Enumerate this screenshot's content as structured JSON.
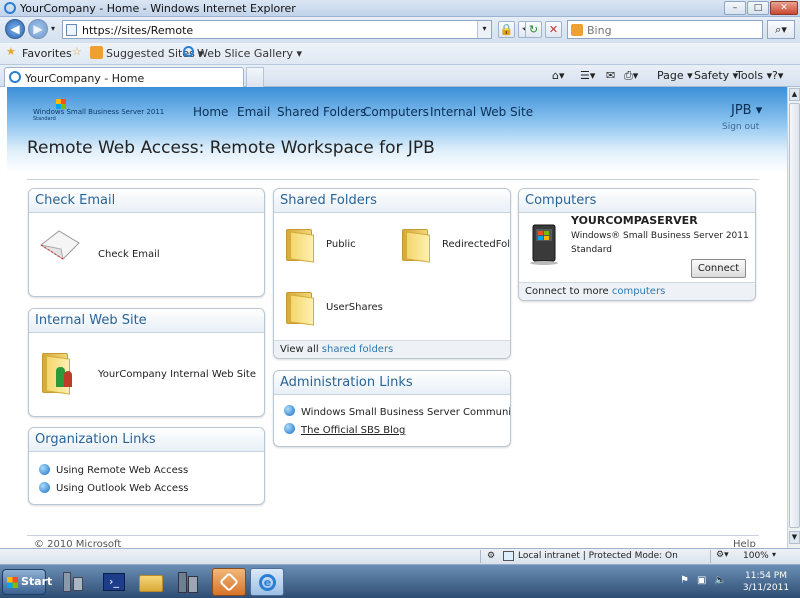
{
  "window": {
    "title": "YourCompany - Home - Windows Internet Explorer",
    "minimize": "–",
    "maximize": "□",
    "close": "✕"
  },
  "address_bar": {
    "url": "https://sites/Remote",
    "search_placeholder": "Bing"
  },
  "favorites_bar": {
    "favorites_label": "Favorites",
    "suggested_sites": "Suggested Sites ▾",
    "web_slice_gallery": "Web Slice Gallery ▾"
  },
  "tabs": [
    {
      "label": "YourCompany - Home"
    }
  ],
  "command_bar": {
    "page": "Page ▾",
    "safety": "Safety ▾",
    "tools": "Tools ▾",
    "help": "?▾"
  },
  "header": {
    "logo_line1": "Windows Small Business Server 2011",
    "logo_line2": "Standard",
    "nav": [
      "Home",
      "Email",
      "Shared Folders",
      "Computers",
      "Internal Web Site"
    ],
    "user": "JPB ▾",
    "sign_out": "Sign out",
    "page_title": "Remote Web Access: Remote Workspace for JPB"
  },
  "check_email": {
    "title": "Check Email",
    "item": "Check Email"
  },
  "internal_web_site": {
    "title": "Internal Web Site",
    "item": "YourCompany Internal Web Site"
  },
  "organization_links": {
    "title": "Organization Links",
    "items": [
      "Using Remote Web Access",
      "Using Outlook Web Access"
    ]
  },
  "shared_folders": {
    "title": "Shared Folders",
    "folders": [
      "Public",
      "RedirectedFol...",
      "UserShares"
    ],
    "footer_prefix": "View all",
    "footer_link": "shared folders"
  },
  "administration_links": {
    "title": "Administration Links",
    "items": [
      "Windows Small Business Server Community",
      "The Official SBS Blog"
    ]
  },
  "computers": {
    "title": "Computers",
    "name": "YOURCOMPASERVER",
    "os": "Windows® Small Business Server 2011",
    "edition": "Standard",
    "connect": "Connect",
    "footer_prefix": "Connect to more",
    "footer_link": "computers"
  },
  "page_footer": {
    "copyright": "© 2010 Microsoft",
    "help": "Help"
  },
  "status_bar": {
    "zone": "Local intranet | Protected Mode: On",
    "zoom": "100%"
  },
  "taskbar": {
    "start": "Start",
    "time": "11:54 PM",
    "date": "3/11/2011"
  }
}
